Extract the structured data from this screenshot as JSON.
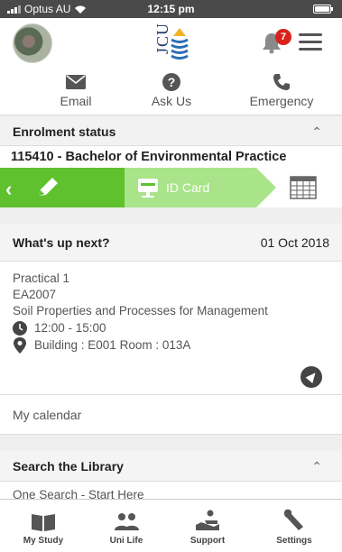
{
  "status_bar": {
    "carrier": "Optus AU",
    "time": "12:15 pm"
  },
  "header": {
    "notification_count": "7"
  },
  "quick_links": [
    {
      "label": "Email",
      "icon": "envelope-icon"
    },
    {
      "label": "Ask Us",
      "icon": "question-icon"
    },
    {
      "label": "Emergency",
      "icon": "phone-icon"
    }
  ],
  "enrolment": {
    "title": "Enrolment status",
    "course": "115410 - Bachelor of Environmental Practice",
    "id_card_label": "ID Card"
  },
  "whats_next": {
    "title": "What's up next?",
    "date": "01 Oct 2018",
    "activity": "Practical 1",
    "subject_code": "EA2007",
    "subject_name": "Soil Properties and Processes for Management",
    "time": "12:00 - 15:00",
    "location": "Building : E001 Room : 013A"
  },
  "my_calendar": "My calendar",
  "library": {
    "title": "Search the Library",
    "link": "One Search - Start Here"
  },
  "tabs": [
    {
      "label": "My Study",
      "icon": "book-icon"
    },
    {
      "label": "Uni Life",
      "icon": "people-icon"
    },
    {
      "label": "Support",
      "icon": "helping-hand-icon"
    },
    {
      "label": "Settings",
      "icon": "wrench-icon"
    }
  ],
  "colors": {
    "accent_green": "#5ec12d",
    "accent_green_light": "#a9e38a",
    "badge_red": "#d9221c"
  }
}
